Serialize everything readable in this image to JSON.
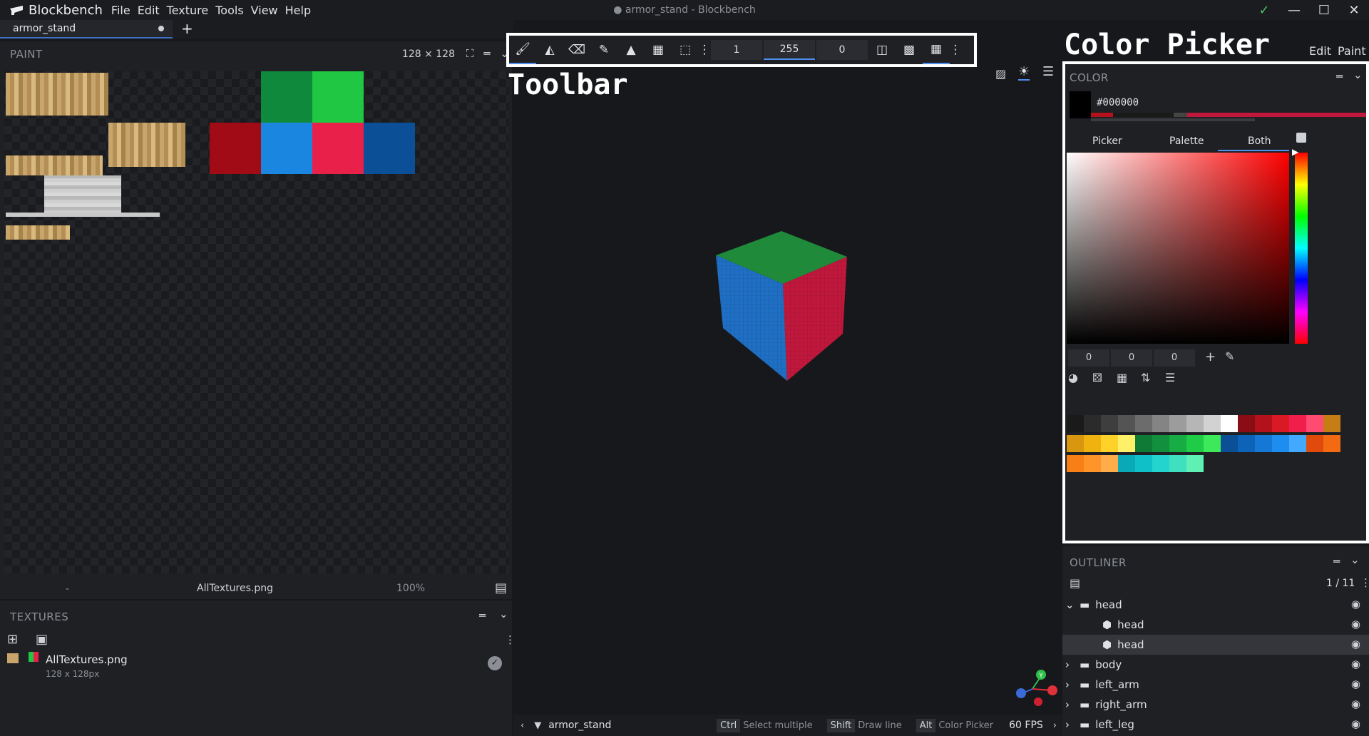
{
  "app": {
    "name": "Blockbench",
    "window_title": "armor_stand - Blockbench",
    "menu": [
      "File",
      "Edit",
      "Texture",
      "Tools",
      "View",
      "Help"
    ]
  },
  "tabs": [
    {
      "label": "armor_stand"
    }
  ],
  "paint_panel": {
    "title": "PAINT",
    "size_label": "128 ⨯ 128",
    "footer": {
      "left": "-",
      "texture_name": "AllTextures.png",
      "zoom": "100%"
    }
  },
  "textures_panel": {
    "title": "TEXTURES",
    "items": [
      {
        "name": "AllTextures.png",
        "size": "128 x 128px"
      }
    ]
  },
  "toolbar": {
    "annotation": "Toolbar",
    "inputs": [
      "1",
      "255",
      "0"
    ]
  },
  "viewport": {
    "model_name": "armor_stand",
    "hints": [
      {
        "key": "Ctrl",
        "label": "Select multiple"
      },
      {
        "key": "Shift",
        "label": "Draw line"
      },
      {
        "key": "Alt",
        "label": "Color Picker"
      }
    ],
    "fps": "60 FPS"
  },
  "right_header": {
    "annotation": "Color Picker",
    "modes": [
      "Edit",
      "Paint"
    ]
  },
  "color_panel": {
    "title": "COLOR",
    "hex": "#000000",
    "tabs": [
      "Picker",
      "Palette",
      "Both"
    ],
    "active_tab": "Both",
    "rgb": [
      "0",
      "0",
      "0"
    ],
    "palette": [
      "#1a1a1a",
      "#2b2b2b",
      "#3e3e3e",
      "#545454",
      "#6c6c6c",
      "#848484",
      "#9c9c9c",
      "#b6b6b6",
      "#d2d2d2",
      "#ffffff",
      "#8a0c14",
      "#b3111c",
      "#d91a24",
      "#ef1e4a",
      "#ff4a72",
      "#c67d14",
      "#d9960f",
      "#f0b20e",
      "#ffd22a",
      "#fff06a",
      "#0f7a36",
      "#12903e",
      "#17ad44",
      "#1fcc45",
      "#3de85a",
      "#0b4f96",
      "#0d63b8",
      "#1478d4",
      "#1d8ef0",
      "#42a9ff",
      "#e04a0a",
      "#f26a12",
      "#f77f16",
      "#ff9528",
      "#ffac4a",
      "#0aa9b8",
      "#10c0c9",
      "#22d4cd",
      "#3fe0c0",
      "#5ff0b4"
    ]
  },
  "outliner": {
    "title": "OUTLINER",
    "count": "1 / 11",
    "rows": [
      {
        "label": "head",
        "type": "group",
        "expanded": true
      },
      {
        "label": "head",
        "type": "cube"
      },
      {
        "label": "head",
        "type": "cube",
        "selected": true
      },
      {
        "label": "body",
        "type": "group"
      },
      {
        "label": "left_arm",
        "type": "group"
      },
      {
        "label": "right_arm",
        "type": "group"
      },
      {
        "label": "left_leg",
        "type": "group"
      }
    ]
  },
  "colors": {
    "accent": "#4f8ff0",
    "panel_bg": "#1f2024",
    "cube_top": "#1f8a3a",
    "cube_left": "#1f6fc4",
    "cube_right": "#c0183c"
  }
}
